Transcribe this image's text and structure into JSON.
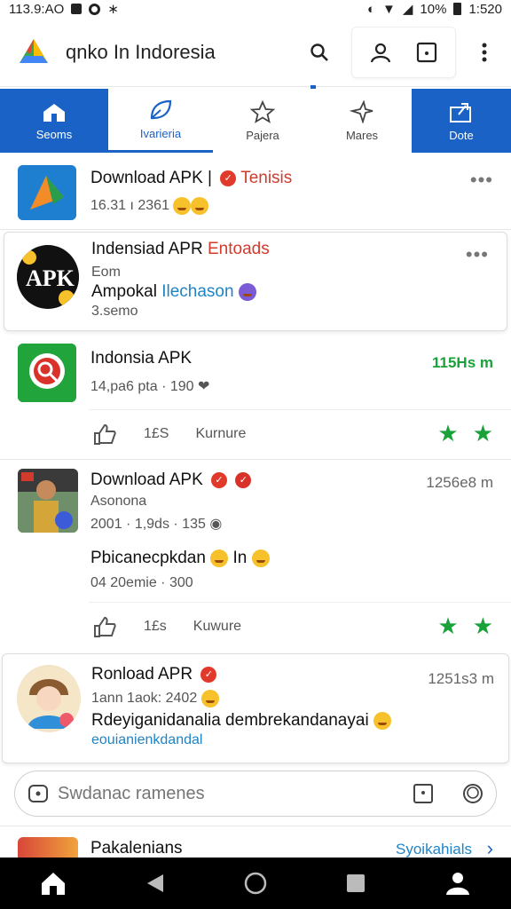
{
  "status": {
    "time": "113.9:AO",
    "battery": "10%",
    "clock": "1:520"
  },
  "app": {
    "title": "qnko In Indoresia"
  },
  "tabs": [
    {
      "label": "Seoms"
    },
    {
      "label": "Ivarieria"
    },
    {
      "label": "Pajera"
    },
    {
      "label": "Mares"
    },
    {
      "label": "Dote"
    }
  ],
  "items": [
    {
      "title": "Download APK |",
      "title_red": "Tenisis",
      "meta": "16.31 ı 2361"
    },
    {
      "title": "Indensiad APR",
      "title_red": "Entoads",
      "line1": "Eom",
      "line2": "Ampokal",
      "line2_blue": "Ilechason",
      "line3": "3.semo"
    },
    {
      "title": "Indonsia APK",
      "time_green": "115Hs m",
      "meta": "14,pa6 pta · 190",
      "likes": "1£S",
      "action": "Kurnure"
    },
    {
      "title": "Download APK",
      "time": "1256e8 m",
      "line1": "Asonona",
      "line2": "2001 · 1,9ds · 135",
      "body": "Pbicanecpkdan",
      "body_suffix": "In",
      "meta": "04 20emie · 300",
      "likes": "1£s",
      "action": "Kuwure"
    },
    {
      "title": "Ronload APR",
      "time": "1251s3 m",
      "line1": "1ann 1aok: 2402",
      "line2": "Rdeyiganidanalia dembrekandanayai",
      "line3": "eouianienkdandal"
    }
  ],
  "search": {
    "placeholder": "Swdanac ramenes"
  },
  "bottom_item": {
    "title": "Pakalenians",
    "link": "Syoikahials"
  },
  "colors": {
    "primary": "#1a62c6",
    "green": "#1aa13a",
    "red": "#d23b2b"
  }
}
